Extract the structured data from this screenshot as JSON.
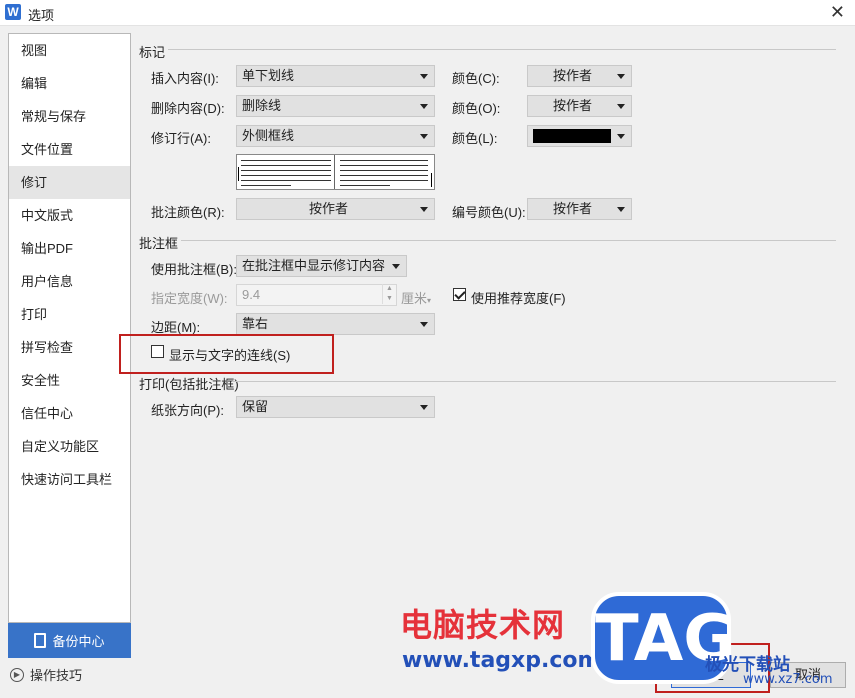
{
  "window": {
    "app_icon": "W",
    "title": "选项",
    "close": "✕"
  },
  "sidebar": {
    "items": [
      {
        "label": "视图"
      },
      {
        "label": "编辑"
      },
      {
        "label": "常规与保存"
      },
      {
        "label": "文件位置"
      },
      {
        "label": "修订",
        "active": true
      },
      {
        "label": "中文版式"
      },
      {
        "label": "输出PDF"
      },
      {
        "label": "用户信息"
      },
      {
        "label": "打印"
      },
      {
        "label": "拼写检查"
      },
      {
        "label": "安全性"
      },
      {
        "label": "信任中心"
      },
      {
        "label": "自定义功能区"
      },
      {
        "label": "快速访问工具栏"
      }
    ],
    "backup_label": "备份中心",
    "tips_label": "操作技巧"
  },
  "markup": {
    "section_title": "标记",
    "insert_label": "插入内容(I):",
    "insert_value": "单下划线",
    "insert_color_label": "颜色(C):",
    "insert_color_value": "按作者",
    "delete_label": "删除内容(D):",
    "delete_value": "删除线",
    "delete_color_label": "颜色(O):",
    "delete_color_value": "按作者",
    "revline_label": "修订行(A):",
    "revline_value": "外侧框线",
    "revline_color_label": "颜色(L):",
    "revline_color": "#000000",
    "comment_color_label": "批注颜色(R):",
    "comment_color_value": "按作者",
    "number_color_label": "编号颜色(U):",
    "number_color_value": "按作者"
  },
  "balloons": {
    "section_title": "批注框",
    "use_label": "使用批注框(B):",
    "use_value": "在批注框中显示修订内容",
    "width_label": "指定宽度(W):",
    "width_value": "9.4",
    "width_unit": "厘米",
    "recommended_label": "使用推荐宽度(F)",
    "recommended_checked": true,
    "margin_label": "边距(M):",
    "margin_value": "靠右",
    "connect_label": "显示与文字的连线(S)",
    "connect_checked": false
  },
  "print": {
    "section_title": "打印(包括批注框)",
    "orientation_label": "纸张方向(P):",
    "orientation_value": "保留"
  },
  "buttons": {
    "ok": "确定",
    "cancel": "取消"
  },
  "watermark": {
    "site_name": "电脑技术网",
    "site_url": "www.tagxp.com",
    "badge": "TAG",
    "logo2_name": "极光下载站",
    "logo2_url": "www.xz7.com"
  }
}
